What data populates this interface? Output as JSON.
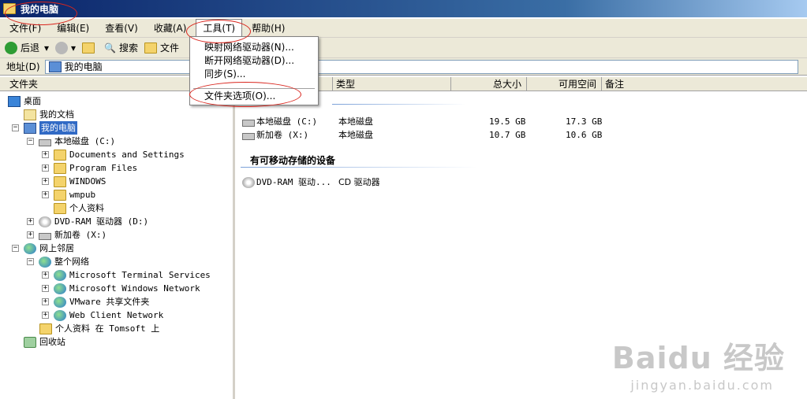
{
  "window": {
    "title": "我的电脑"
  },
  "menubar": [
    {
      "label": "文件(F)"
    },
    {
      "label": "编辑(E)"
    },
    {
      "label": "查看(V)"
    },
    {
      "label": "收藏(A)"
    },
    {
      "label": "工具(T)"
    },
    {
      "label": "帮助(H)"
    }
  ],
  "toolbar": {
    "back": "后退",
    "search": "搜索",
    "folders": "文件"
  },
  "address": {
    "label": "地址(D)",
    "value": "我的电脑"
  },
  "tools_menu": {
    "items": [
      "映射网络驱动器(N)...",
      "断开网络驱动器(D)...",
      "同步(S)...",
      "文件夹选项(O)..."
    ]
  },
  "tree": {
    "header": "文件夹",
    "items": [
      {
        "label": "桌面"
      },
      {
        "label": "我的文档"
      },
      {
        "label": "我的电脑"
      },
      {
        "label": "本地磁盘 (C:)"
      },
      {
        "label": "Documents and Settings"
      },
      {
        "label": "Program Files"
      },
      {
        "label": "WINDOWS"
      },
      {
        "label": "wmpub"
      },
      {
        "label": "个人资料"
      },
      {
        "label": "DVD-RAM 驱动器 (D:)"
      },
      {
        "label": "新加卷 (X:)"
      },
      {
        "label": "网上邻居"
      },
      {
        "label": "整个网络"
      },
      {
        "label": "Microsoft Terminal Services"
      },
      {
        "label": "Microsoft Windows Network"
      },
      {
        "label": "VMware 共享文件夹"
      },
      {
        "label": "Web Client Network"
      },
      {
        "label": "个人资料 在 Tomsoft 上"
      },
      {
        "label": "回收站"
      }
    ]
  },
  "list": {
    "columns": [
      "类型",
      "总大小",
      "可用空间",
      "备注"
    ],
    "drives": [
      {
        "name": "本地磁盘 (C:)",
        "type": "本地磁盘",
        "total": "19.5 GB",
        "free": "17.3 GB"
      },
      {
        "name": "新加卷 (X:)",
        "type": "本地磁盘",
        "total": "10.7 GB",
        "free": "10.6 GB"
      }
    ],
    "removable_section": "有可移动存储的设备",
    "removable": [
      {
        "name": "DVD-RAM 驱动...",
        "type": "CD 驱动器"
      }
    ]
  },
  "watermark": {
    "brand": "Baidu 经验",
    "url": "jingyan.baidu.com"
  }
}
